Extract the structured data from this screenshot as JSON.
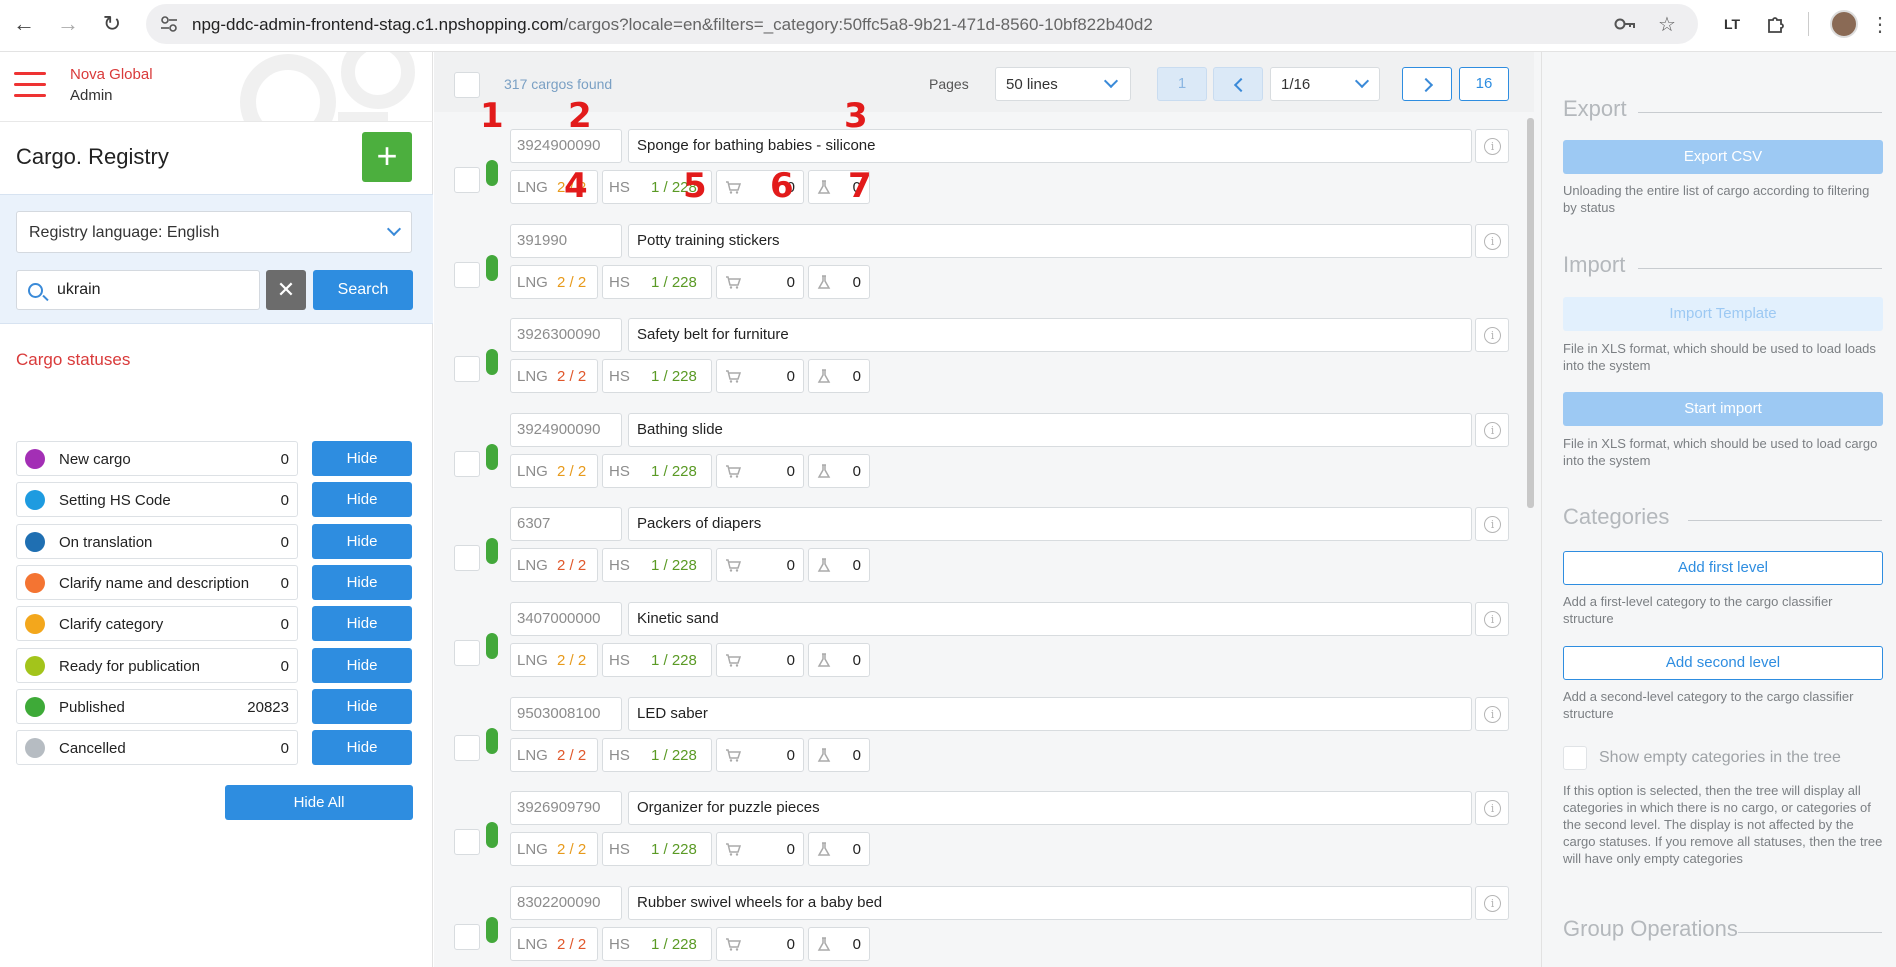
{
  "browser": {
    "url_host": "npg-ddc-admin-frontend-stag.c1.npshopping.com",
    "url_path": "/cargos?locale=en&filters=_category:50ffc5a8-9b21-471d-8560-10bf822b40d2"
  },
  "header": {
    "brand_line1": "Nova Global",
    "brand_line2": "Admin"
  },
  "sidebar": {
    "title": "Cargo. Registry",
    "add_label": "+",
    "language_select": "Registry language: English",
    "search_value": "ukrain",
    "search_button": "Search",
    "clear_label": "✕",
    "statuses_title": "Cargo statuses",
    "hide_label": "Hide",
    "hide_all": "Hide All",
    "statuses": [
      {
        "name": "New cargo",
        "count": "0",
        "color": "#a32fb5"
      },
      {
        "name": "Setting HS Code",
        "count": "0",
        "color": "#1e9be0"
      },
      {
        "name": "On translation",
        "count": "0",
        "color": "#1f6fb2"
      },
      {
        "name": "Clarify name and description",
        "count": "0",
        "color": "#f47432"
      },
      {
        "name": "Clarify category",
        "count": "0",
        "color": "#f3a71c"
      },
      {
        "name": "Ready for publication",
        "count": "0",
        "color": "#a3c41b"
      },
      {
        "name": "Published",
        "count": "20823",
        "color": "#3eaa38"
      },
      {
        "name": "Cancelled",
        "count": "0",
        "color": "#b6bcc2"
      }
    ]
  },
  "toolbar": {
    "found": "317 cargos found",
    "pages_label": "Pages",
    "lines_select": "50 lines",
    "first_page": "1",
    "page_select": "1/16",
    "last_page": "16"
  },
  "row_labels": {
    "lng": "LNG",
    "hs": "HS"
  },
  "cargos": [
    {
      "code": "3924900090",
      "name": "Sponge for bathing babies - silicone",
      "lng": "2 / 2",
      "lng_color": "orange",
      "hs": "1 / 228",
      "cart": "0",
      "lab": "0"
    },
    {
      "code": "391990",
      "name": "Potty training stickers",
      "lng": "2 / 2",
      "lng_color": "orange",
      "hs": "1 / 228",
      "cart": "0",
      "lab": "0"
    },
    {
      "code": "3926300090",
      "name": "Safety belt for furniture",
      "lng": "2 / 2",
      "lng_color": "red",
      "hs": "1 / 228",
      "cart": "0",
      "lab": "0"
    },
    {
      "code": "3924900090",
      "name": "Bathing slide",
      "lng": "2 / 2",
      "lng_color": "orange",
      "hs": "1 / 228",
      "cart": "0",
      "lab": "0"
    },
    {
      "code": "6307",
      "name": "Packers of diapers",
      "lng": "2 / 2",
      "lng_color": "red",
      "hs": "1 / 228",
      "cart": "0",
      "lab": "0"
    },
    {
      "code": "3407000000",
      "name": "Kinetic sand",
      "lng": "2 / 2",
      "lng_color": "orange",
      "hs": "1 / 228",
      "cart": "0",
      "lab": "0"
    },
    {
      "code": "9503008100",
      "name": "LED saber",
      "lng": "2 / 2",
      "lng_color": "red",
      "hs": "1 / 228",
      "cart": "0",
      "lab": "0"
    },
    {
      "code": "3926909790",
      "name": "Organizer for puzzle pieces",
      "lng": "2 / 2",
      "lng_color": "orange",
      "hs": "1 / 228",
      "cart": "0",
      "lab": "0"
    },
    {
      "code": "8302200090",
      "name": "Rubber swivel wheels for a baby bed",
      "lng": "2 / 2",
      "lng_color": "red",
      "hs": "1 / 228",
      "cart": "0",
      "lab": "0"
    }
  ],
  "annotations": [
    "1",
    "2",
    "3",
    "4",
    "5",
    "6",
    "7"
  ],
  "right_panel": {
    "export_title": "Export",
    "export_btn": "Export CSV",
    "export_desc": "Unloading the entire list of cargo according to filtering by status",
    "import_title": "Import",
    "import_template_btn": "Import Template",
    "import_template_desc": "File in XLS format, which should be used to load loads into the system",
    "start_import_btn": "Start import",
    "start_import_desc": "File in XLS format, which should be used to load cargo into the system",
    "categories_title": "Categories",
    "add_first_btn": "Add first level",
    "add_first_desc": "Add a first-level category to the cargo classifier structure",
    "add_second_btn": "Add second level",
    "add_second_desc": "Add a second-level category to the cargo classifier structure",
    "show_empty_label": "Show empty categories in the tree",
    "show_empty_desc": "If this option is selected, then the tree will display all categories in which there is no cargo, or categories of the second level. The display is not affected by the cargo statuses. If you remove all statuses, then the tree will have only empty categories",
    "group_ops_title": "Group Operations"
  }
}
